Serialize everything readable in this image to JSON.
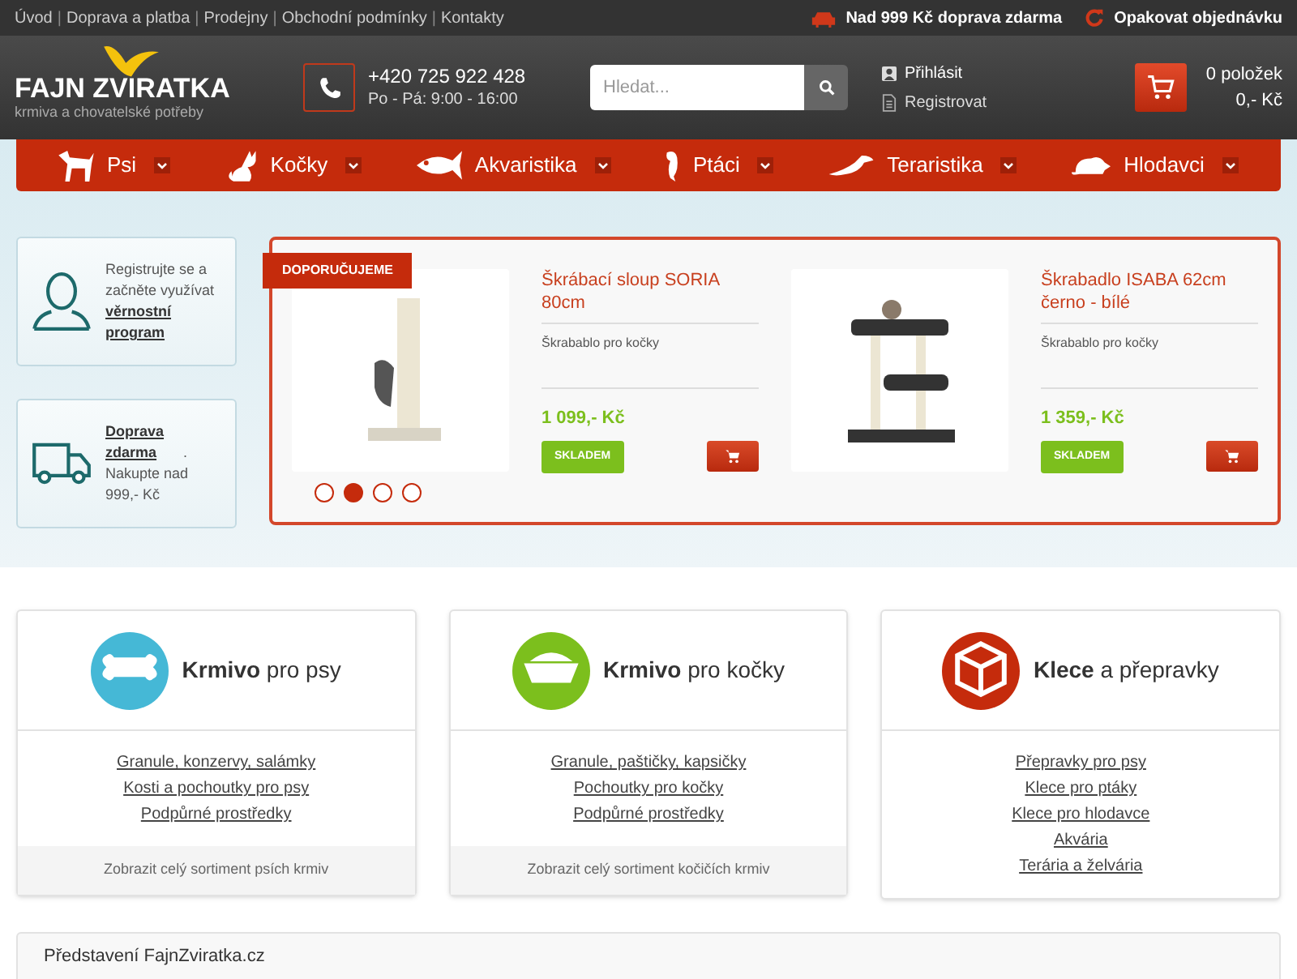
{
  "top_links": [
    "Úvod",
    "Doprava a platba",
    "Prodejny",
    "Obchodní podmínky",
    "Kontakty"
  ],
  "top_link_separator": "|",
  "top_right": [
    {
      "kind": "car",
      "label": "Nad 999 Kč doprava zdarma"
    },
    {
      "kind": "repeat",
      "label": "Opakovat objednávku"
    }
  ],
  "logo": {
    "name": "FAJN ZVIRATKA",
    "tagline": "krmiva a chovatelské potřeby"
  },
  "phone": {
    "number": "+420 725 922 428",
    "hours": "Po - Pá: 9:00 - 16:00"
  },
  "search": {
    "placeholder": "Hledat..."
  },
  "account": [
    {
      "kind": "user",
      "label": "Přihlásit"
    },
    {
      "kind": "doc",
      "label": "Registrovat"
    }
  ],
  "cart": {
    "items": "0 položek",
    "total": "0,- Kč"
  },
  "nav": [
    "Psi",
    "Kočky",
    "Akvaristika",
    "Ptáci",
    "Teraristika",
    "Hlodavci"
  ],
  "promos": [
    {
      "kind": "user",
      "text": "Registrujte se a začněte využívat ",
      "link": "věrnostní program"
    },
    {
      "kind": "truck",
      "link": "Doprava zdarma",
      "after": ". Nakupte nad 999,- Kč"
    }
  ],
  "carousel": {
    "badge": "DOPORUČUJEME",
    "products": [
      {
        "title": "Škrábací sloup SORIA 80cm",
        "subtitle": "Škrabablo pro kočky",
        "price": "1 099,- Kč",
        "stock": "SKLADEM"
      },
      {
        "title": "Škrabadlo ISABA 62cm černo - bílé",
        "subtitle": "Škrabablo pro kočky",
        "price": "1 359,- Kč",
        "stock": "SKLADEM"
      }
    ],
    "dots": [
      {
        "selected": false
      },
      {
        "selected": true
      },
      {
        "selected": false
      },
      {
        "selected": false
      }
    ]
  },
  "categories": [
    {
      "title": "**Krmivo** pro psy",
      "color": "#45b8d6",
      "links": [
        "Granule, konzervy, salámky",
        "Kosti a pochoutky pro psy",
        "Podpůrné prostředky"
      ],
      "footer": "Zobrazit celý sortiment psích krmiv"
    },
    {
      "title": "**Krmivo** pro kočky",
      "color": "#7cbf1d",
      "links": [
        "Granule, paštičky, kapsičky",
        "Pochoutky pro kočky",
        "Podpůrné prostředky"
      ],
      "footer": "Zobrazit celý sortiment kočičích krmiv"
    },
    {
      "title": "**Klece** a přepravky",
      "color": "#c52b0c",
      "links": [
        "Přepravky pro psy",
        "Klece pro ptáky",
        "Klece pro hlodavce",
        "Akvária",
        "Terária a želvária"
      ]
    }
  ],
  "intro": {
    "title": "Představení FajnZviratka.cz"
  }
}
